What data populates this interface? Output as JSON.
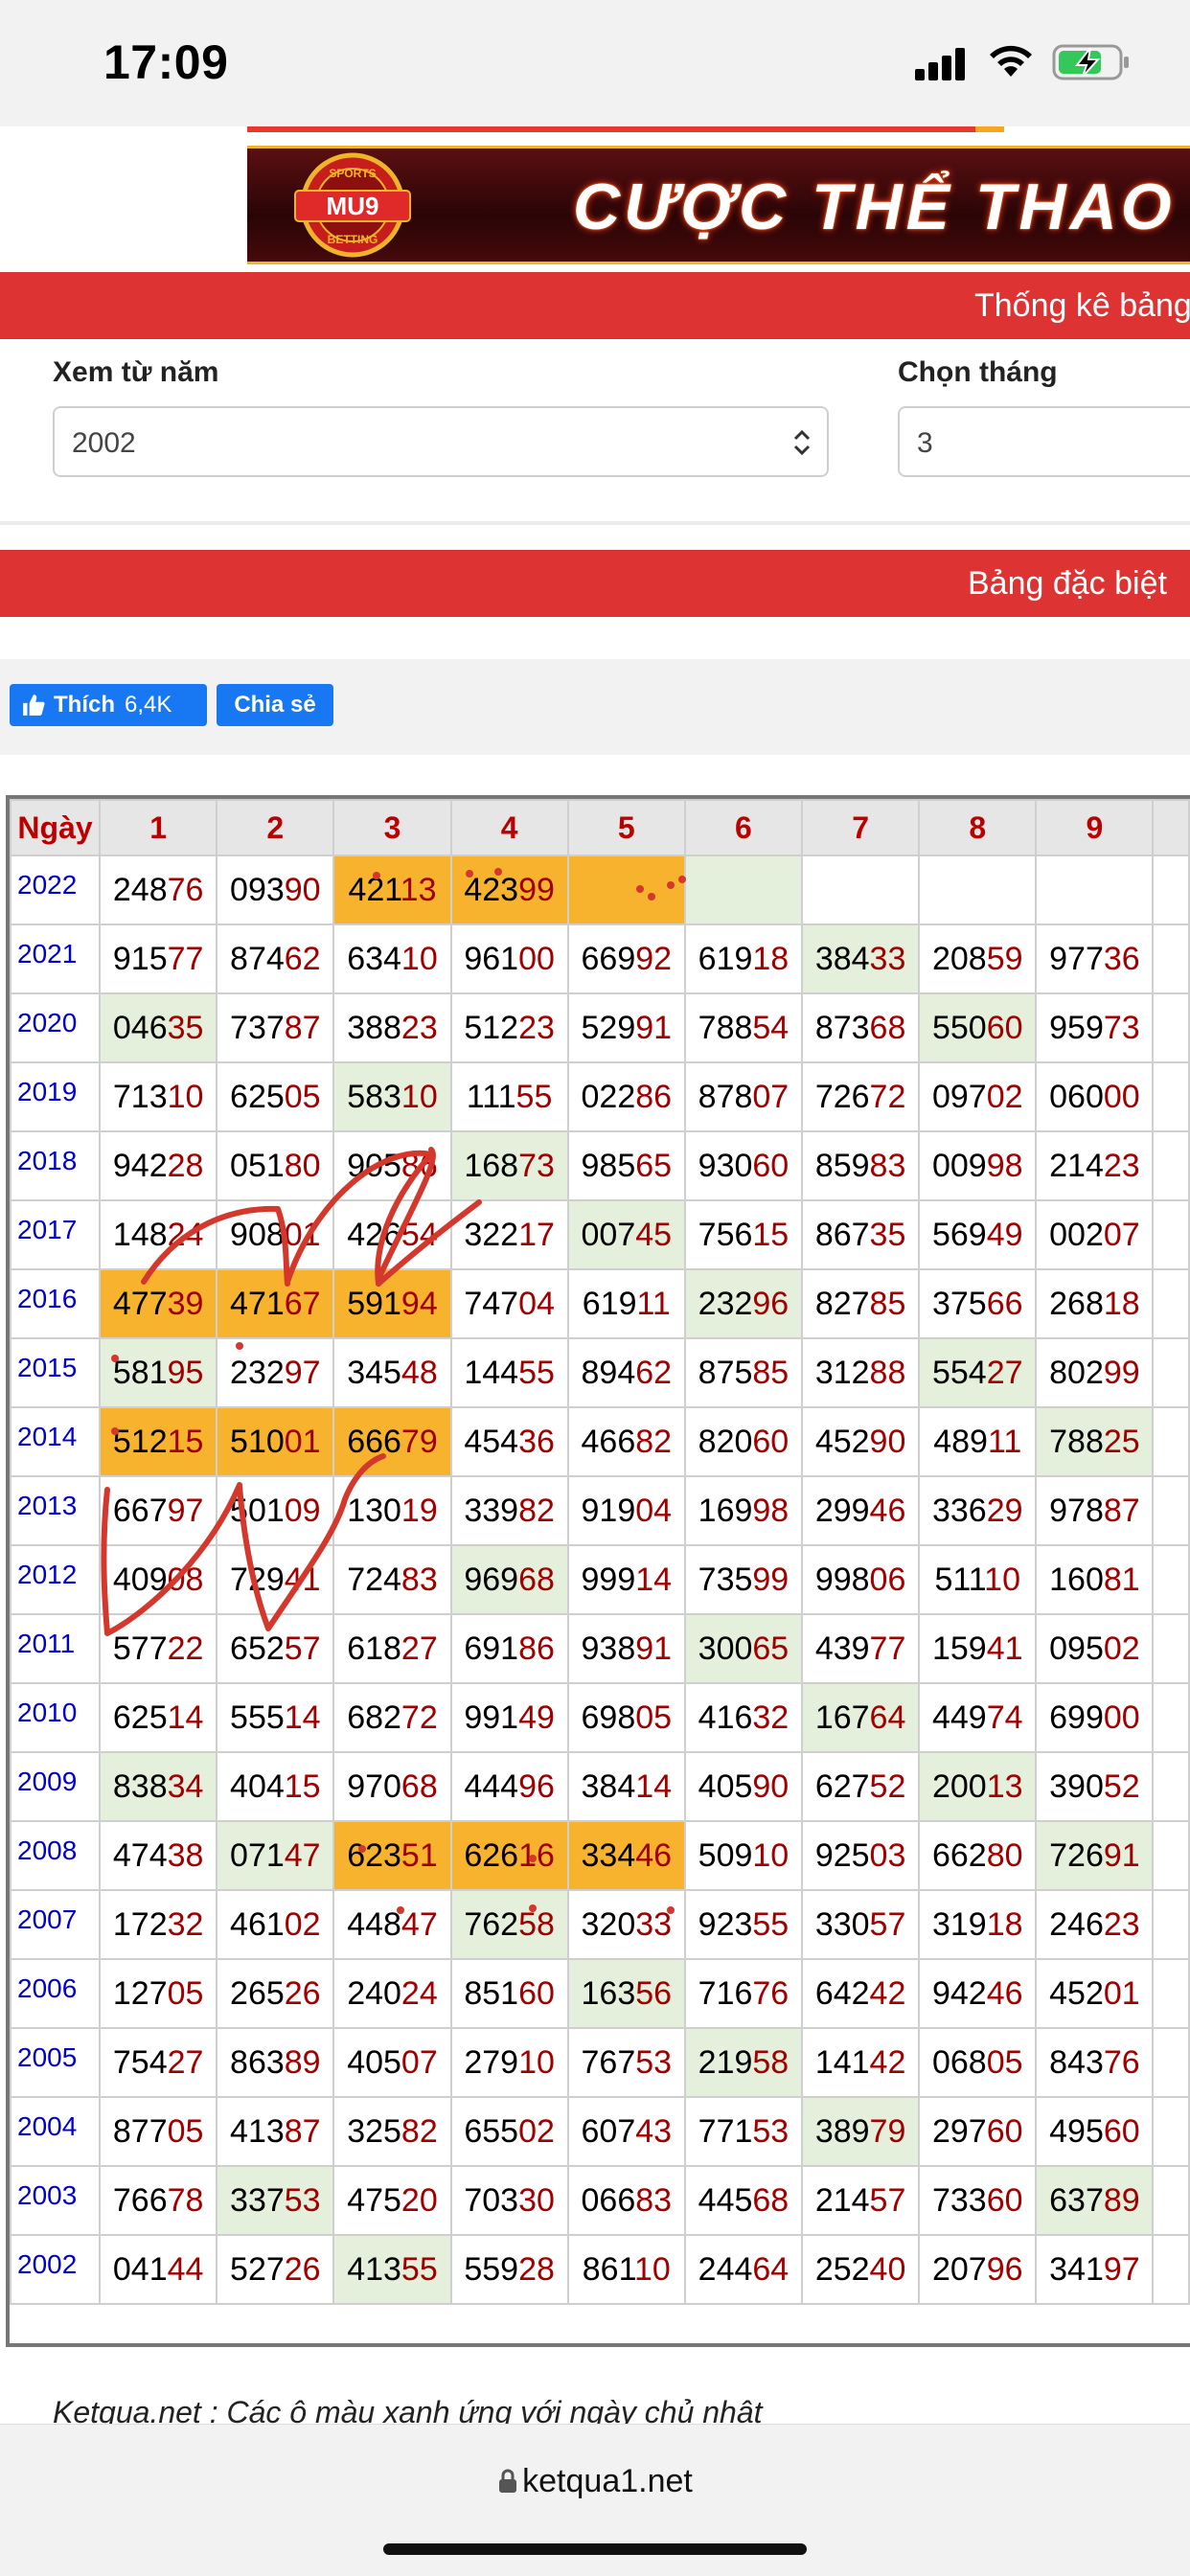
{
  "status": {
    "time": "17:09"
  },
  "banner": {
    "logo_text": "MU9",
    "logo_top": "SPORTS",
    "logo_bottom": "BETTING",
    "text": "CƯỢC THỂ THAO"
  },
  "section1": {
    "title": "Thống kê bảng"
  },
  "filters": {
    "year_label": "Xem từ năm",
    "year_value": "2002",
    "month_label": "Chọn tháng",
    "month_value": "3"
  },
  "section2": {
    "title": "Bảng đặc biệt"
  },
  "social": {
    "like_label": "Thích",
    "like_count": "6,4K",
    "share_label": "Chia sẻ"
  },
  "table": {
    "header": [
      "Ngày",
      "1",
      "2",
      "3",
      "4",
      "5",
      "6",
      "7",
      "8",
      "9"
    ],
    "rows": [
      {
        "year": "2022",
        "cells": [
          {
            "head": "248",
            "tail": "76"
          },
          {
            "head": "093",
            "tail": "90"
          },
          {
            "head": "421",
            "tail": "13",
            "bg": "orange"
          },
          {
            "head": "423",
            "tail": "99",
            "bg": "orange"
          },
          {
            "head": "",
            "tail": "",
            "bg": "orange"
          },
          {
            "head": "",
            "tail": "",
            "bg": "green"
          },
          {
            "head": "",
            "tail": ""
          },
          {
            "head": "",
            "tail": ""
          },
          {
            "head": "",
            "tail": ""
          }
        ]
      },
      {
        "year": "2021",
        "cells": [
          {
            "head": "915",
            "tail": "77"
          },
          {
            "head": "874",
            "tail": "62"
          },
          {
            "head": "634",
            "tail": "10"
          },
          {
            "head": "961",
            "tail": "00"
          },
          {
            "head": "669",
            "tail": "92"
          },
          {
            "head": "619",
            "tail": "18"
          },
          {
            "head": "384",
            "tail": "33",
            "bg": "green"
          },
          {
            "head": "208",
            "tail": "59"
          },
          {
            "head": "977",
            "tail": "36"
          }
        ]
      },
      {
        "year": "2020",
        "cells": [
          {
            "head": "046",
            "tail": "35",
            "bg": "green"
          },
          {
            "head": "737",
            "tail": "87"
          },
          {
            "head": "388",
            "tail": "23"
          },
          {
            "head": "512",
            "tail": "23"
          },
          {
            "head": "529",
            "tail": "91"
          },
          {
            "head": "788",
            "tail": "54"
          },
          {
            "head": "873",
            "tail": "68"
          },
          {
            "head": "550",
            "tail": "60",
            "bg": "green"
          },
          {
            "head": "959",
            "tail": "73"
          }
        ]
      },
      {
        "year": "2019",
        "cells": [
          {
            "head": "713",
            "tail": "10"
          },
          {
            "head": "625",
            "tail": "05"
          },
          {
            "head": "583",
            "tail": "10",
            "bg": "green"
          },
          {
            "head": "111",
            "tail": "55"
          },
          {
            "head": "022",
            "tail": "86"
          },
          {
            "head": "878",
            "tail": "07"
          },
          {
            "head": "726",
            "tail": "72"
          },
          {
            "head": "097",
            "tail": "02"
          },
          {
            "head": "060",
            "tail": "00"
          }
        ]
      },
      {
        "year": "2018",
        "cells": [
          {
            "head": "942",
            "tail": "28"
          },
          {
            "head": "051",
            "tail": "80"
          },
          {
            "head": "905",
            "tail": "86"
          },
          {
            "head": "168",
            "tail": "73",
            "bg": "green"
          },
          {
            "head": "985",
            "tail": "65"
          },
          {
            "head": "930",
            "tail": "60"
          },
          {
            "head": "859",
            "tail": "83"
          },
          {
            "head": "009",
            "tail": "98"
          },
          {
            "head": "214",
            "tail": "23"
          }
        ]
      },
      {
        "year": "2017",
        "cells": [
          {
            "head": "148",
            "tail": "24"
          },
          {
            "head": "908",
            "tail": "01"
          },
          {
            "head": "426",
            "tail": "54"
          },
          {
            "head": "322",
            "tail": "17"
          },
          {
            "head": "007",
            "tail": "45",
            "bg": "green"
          },
          {
            "head": "756",
            "tail": "15"
          },
          {
            "head": "867",
            "tail": "35"
          },
          {
            "head": "569",
            "tail": "49"
          },
          {
            "head": "002",
            "tail": "07"
          }
        ]
      },
      {
        "year": "2016",
        "cells": [
          {
            "head": "477",
            "tail": "39",
            "bg": "orange"
          },
          {
            "head": "471",
            "tail": "67",
            "bg": "orange"
          },
          {
            "head": "591",
            "tail": "94",
            "bg": "orange"
          },
          {
            "head": "747",
            "tail": "04"
          },
          {
            "head": "619",
            "tail": "11"
          },
          {
            "head": "232",
            "tail": "96",
            "bg": "green"
          },
          {
            "head": "827",
            "tail": "85"
          },
          {
            "head": "375",
            "tail": "66"
          },
          {
            "head": "268",
            "tail": "18"
          }
        ]
      },
      {
        "year": "2015",
        "cells": [
          {
            "head": "581",
            "tail": "95",
            "bg": "green"
          },
          {
            "head": "232",
            "tail": "97"
          },
          {
            "head": "345",
            "tail": "48"
          },
          {
            "head": "144",
            "tail": "55"
          },
          {
            "head": "894",
            "tail": "62"
          },
          {
            "head": "875",
            "tail": "85"
          },
          {
            "head": "312",
            "tail": "88"
          },
          {
            "head": "554",
            "tail": "27",
            "bg": "green"
          },
          {
            "head": "802",
            "tail": "99"
          }
        ]
      },
      {
        "year": "2014",
        "cells": [
          {
            "head": "512",
            "tail": "15",
            "bg": "orange"
          },
          {
            "head": "510",
            "tail": "01",
            "bg": "orange"
          },
          {
            "head": "666",
            "tail": "79",
            "bg": "orange"
          },
          {
            "head": "454",
            "tail": "36"
          },
          {
            "head": "466",
            "tail": "82"
          },
          {
            "head": "820",
            "tail": "60"
          },
          {
            "head": "452",
            "tail": "90"
          },
          {
            "head": "489",
            "tail": "11"
          },
          {
            "head": "788",
            "tail": "25",
            "bg": "green"
          }
        ]
      },
      {
        "year": "2013",
        "cells": [
          {
            "head": "667",
            "tail": "97"
          },
          {
            "head": "501",
            "tail": "09"
          },
          {
            "head": "130",
            "tail": "19"
          },
          {
            "head": "339",
            "tail": "82"
          },
          {
            "head": "919",
            "tail": "04"
          },
          {
            "head": "169",
            "tail": "98"
          },
          {
            "head": "299",
            "tail": "46"
          },
          {
            "head": "336",
            "tail": "29"
          },
          {
            "head": "978",
            "tail": "87"
          }
        ]
      },
      {
        "year": "2012",
        "cells": [
          {
            "head": "409",
            "tail": "08"
          },
          {
            "head": "729",
            "tail": "41"
          },
          {
            "head": "724",
            "tail": "83"
          },
          {
            "head": "969",
            "tail": "68",
            "bg": "green"
          },
          {
            "head": "999",
            "tail": "14"
          },
          {
            "head": "735",
            "tail": "99"
          },
          {
            "head": "998",
            "tail": "06"
          },
          {
            "head": "511",
            "tail": "10"
          },
          {
            "head": "160",
            "tail": "81"
          }
        ]
      },
      {
        "year": "2011",
        "cells": [
          {
            "head": "577",
            "tail": "22"
          },
          {
            "head": "652",
            "tail": "57"
          },
          {
            "head": "618",
            "tail": "27"
          },
          {
            "head": "691",
            "tail": "86"
          },
          {
            "head": "938",
            "tail": "91"
          },
          {
            "head": "300",
            "tail": "65",
            "bg": "green"
          },
          {
            "head": "439",
            "tail": "77"
          },
          {
            "head": "159",
            "tail": "41"
          },
          {
            "head": "095",
            "tail": "02"
          }
        ]
      },
      {
        "year": "2010",
        "cells": [
          {
            "head": "625",
            "tail": "14"
          },
          {
            "head": "555",
            "tail": "14"
          },
          {
            "head": "682",
            "tail": "72"
          },
          {
            "head": "991",
            "tail": "49"
          },
          {
            "head": "698",
            "tail": "05"
          },
          {
            "head": "416",
            "tail": "32"
          },
          {
            "head": "167",
            "tail": "64",
            "bg": "green"
          },
          {
            "head": "449",
            "tail": "74"
          },
          {
            "head": "699",
            "tail": "00"
          }
        ]
      },
      {
        "year": "2009",
        "cells": [
          {
            "head": "838",
            "tail": "34",
            "bg": "green"
          },
          {
            "head": "404",
            "tail": "15"
          },
          {
            "head": "970",
            "tail": "68"
          },
          {
            "head": "444",
            "tail": "96"
          },
          {
            "head": "384",
            "tail": "14"
          },
          {
            "head": "405",
            "tail": "90"
          },
          {
            "head": "627",
            "tail": "52"
          },
          {
            "head": "200",
            "tail": "13",
            "bg": "green"
          },
          {
            "head": "390",
            "tail": "52"
          }
        ]
      },
      {
        "year": "2008",
        "cells": [
          {
            "head": "474",
            "tail": "38"
          },
          {
            "head": "071",
            "tail": "47",
            "bg": "green"
          },
          {
            "head": "623",
            "tail": "51",
            "bg": "orange"
          },
          {
            "head": "626",
            "tail": "16",
            "bg": "orange"
          },
          {
            "head": "334",
            "tail": "46",
            "bg": "orange"
          },
          {
            "head": "509",
            "tail": "10"
          },
          {
            "head": "925",
            "tail": "03"
          },
          {
            "head": "662",
            "tail": "80"
          },
          {
            "head": "726",
            "tail": "91",
            "bg": "green"
          }
        ]
      },
      {
        "year": "2007",
        "cells": [
          {
            "head": "172",
            "tail": "32"
          },
          {
            "head": "461",
            "tail": "02"
          },
          {
            "head": "448",
            "tail": "47"
          },
          {
            "head": "762",
            "tail": "58",
            "bg": "green"
          },
          {
            "head": "320",
            "tail": "33"
          },
          {
            "head": "923",
            "tail": "55"
          },
          {
            "head": "330",
            "tail": "57"
          },
          {
            "head": "319",
            "tail": "18"
          },
          {
            "head": "246",
            "tail": "23"
          }
        ]
      },
      {
        "year": "2006",
        "cells": [
          {
            "head": "127",
            "tail": "05"
          },
          {
            "head": "265",
            "tail": "26"
          },
          {
            "head": "240",
            "tail": "24"
          },
          {
            "head": "851",
            "tail": "60"
          },
          {
            "head": "163",
            "tail": "56",
            "bg": "green"
          },
          {
            "head": "716",
            "tail": "76"
          },
          {
            "head": "642",
            "tail": "42"
          },
          {
            "head": "942",
            "tail": "46"
          },
          {
            "head": "452",
            "tail": "01"
          }
        ]
      },
      {
        "year": "2005",
        "cells": [
          {
            "head": "754",
            "tail": "27"
          },
          {
            "head": "863",
            "tail": "89"
          },
          {
            "head": "405",
            "tail": "07"
          },
          {
            "head": "279",
            "tail": "10"
          },
          {
            "head": "767",
            "tail": "53"
          },
          {
            "head": "219",
            "tail": "58",
            "bg": "green"
          },
          {
            "head": "141",
            "tail": "42"
          },
          {
            "head": "068",
            "tail": "05"
          },
          {
            "head": "843",
            "tail": "76"
          }
        ]
      },
      {
        "year": "2004",
        "cells": [
          {
            "head": "877",
            "tail": "05"
          },
          {
            "head": "413",
            "tail": "87"
          },
          {
            "head": "325",
            "tail": "82"
          },
          {
            "head": "655",
            "tail": "02"
          },
          {
            "head": "607",
            "tail": "43"
          },
          {
            "head": "771",
            "tail": "53"
          },
          {
            "head": "389",
            "tail": "79",
            "bg": "green"
          },
          {
            "head": "297",
            "tail": "60"
          },
          {
            "head": "495",
            "tail": "60"
          }
        ]
      },
      {
        "year": "2003",
        "cells": [
          {
            "head": "766",
            "tail": "78"
          },
          {
            "head": "337",
            "tail": "53",
            "bg": "green"
          },
          {
            "head": "475",
            "tail": "20"
          },
          {
            "head": "703",
            "tail": "30"
          },
          {
            "head": "066",
            "tail": "83"
          },
          {
            "head": "445",
            "tail": "68"
          },
          {
            "head": "214",
            "tail": "57"
          },
          {
            "head": "733",
            "tail": "60"
          },
          {
            "head": "637",
            "tail": "89",
            "bg": "green"
          }
        ]
      },
      {
        "year": "2002",
        "cells": [
          {
            "head": "041",
            "tail": "44"
          },
          {
            "head": "527",
            "tail": "26"
          },
          {
            "head": "413",
            "tail": "55",
            "bg": "green"
          },
          {
            "head": "559",
            "tail": "28"
          },
          {
            "head": "861",
            "tail": "10"
          },
          {
            "head": "244",
            "tail": "64"
          },
          {
            "head": "252",
            "tail": "40"
          },
          {
            "head": "207",
            "tail": "96"
          },
          {
            "head": "341",
            "tail": "97"
          }
        ]
      }
    ]
  },
  "note": {
    "text": "Ketqua.net : Các ô màu xanh ứng với ngày chủ nhật"
  },
  "browser": {
    "url": "ketqua1.net"
  },
  "colors": {
    "header_red": "#dd3333",
    "sunday_green": "#e4f0dc",
    "highlight_orange": "#f7b32d",
    "tail_red": "#a00000",
    "year_blue": "#0000cc"
  }
}
